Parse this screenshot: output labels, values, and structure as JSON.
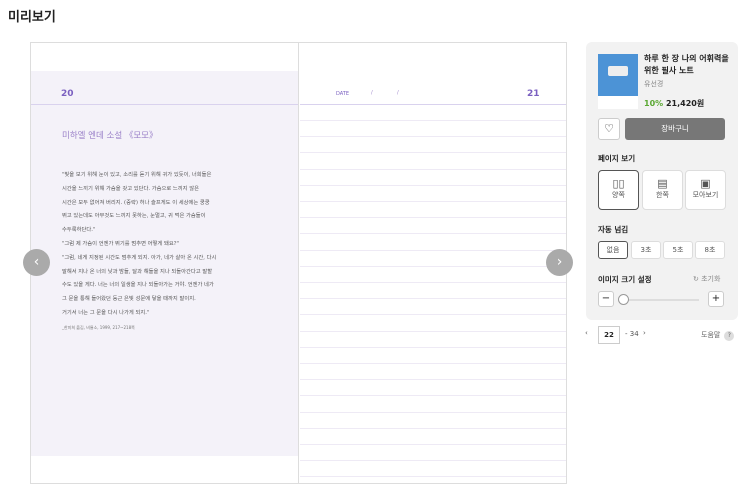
{
  "header": {
    "title": "미리보기"
  },
  "left_page": {
    "number": "20",
    "title": "미하엘 엔데 소설 《모모》",
    "text": "\"빛을 보기 위해 눈이 있고, 소리를 듣기 위해 귀가 있듯이, 너희들은\n시간을 느끼기 위해 가슴을 갖고 있단다. 가슴으로 느끼지 않은\n시간은 모두 없어져 버리지. (중략) 허나 슬프게도 이 세상에는 쿵쿵\n뛰고 있는데도 아무것도 느끼지 못하는, 눈멀고, 귀 먹은 가슴들이\n수두룩하단다.\"\n\"그럼 제 가슴이 언젠가 뛰기를 멈추면 어떻게 돼요?\"\n\"그럼, 네게 지정된 시간도 멈추게 되지. 아가, 네가 살아 온 시간, 다시\n말해서 지나 온 너의 낮과 밤들, 달과 해들을 지나 되돌아간다고 말할\n수도 있을 게다. 너는 너의 일생을 지나 되돌아가는 거야. 언젠가 네가\n그 문을 통해 들어왔던 둥근 은빛 성문에 닿을 때까지 말이지.\n거기서 너는 그 문을 다시 나가게 되지.\"",
    "source": "_한미희 옮김, 비룡소, 1999, 217~218쪽"
  },
  "right_page": {
    "number": "21",
    "date_label": "DATE",
    "date_sep": "/"
  },
  "book": {
    "title": "하루 한 장 나의 어휘력을 위한 필사 노트",
    "author": "유선경",
    "discount": "10%",
    "price": "21,420원"
  },
  "actions": {
    "cart": "장바구니",
    "wishlist_icon": "heart-icon"
  },
  "view": {
    "label": "페이지 보기",
    "options": [
      "양쪽",
      "한쪽",
      "모아보기"
    ],
    "selected": "양쪽"
  },
  "auto": {
    "label": "자동 넘김",
    "options": [
      "없음",
      "3초",
      "5초",
      "8초"
    ],
    "selected": "없음"
  },
  "zoom": {
    "label": "이미지 크기 설정",
    "reset": "초기화",
    "minus": "−",
    "plus": "+",
    "level": 0
  },
  "pager": {
    "current": "22",
    "total": "- 34",
    "help": "도움말",
    "help_icon": "?"
  }
}
